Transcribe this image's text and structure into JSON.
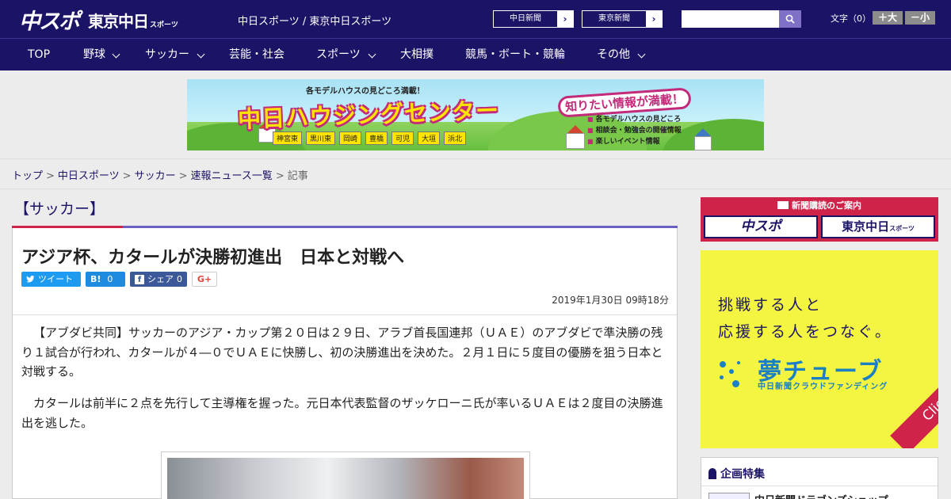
{
  "header": {
    "logo_chuspo": "中スポ",
    "logo_tokyo": "東京中日",
    "logo_tokyo_small": "スポーツ",
    "site_name": "中日スポーツ / 東京中日スポーツ",
    "paper_links": [
      {
        "label": "中日新聞"
      },
      {
        "label": "東京新聞"
      }
    ],
    "search_placeholder": "",
    "font_size_label": "文字（0）",
    "font_larger": "＋大",
    "font_smaller": "－小"
  },
  "nav": {
    "items": [
      {
        "label": "TOP",
        "dropdown": false
      },
      {
        "label": "野球",
        "dropdown": true
      },
      {
        "label": "サッカー",
        "dropdown": true
      },
      {
        "label": "芸能・社会",
        "dropdown": false
      },
      {
        "label": "スポーツ",
        "dropdown": true
      },
      {
        "label": "大相撲",
        "dropdown": false
      },
      {
        "label": "競馬・ボート・競輪",
        "dropdown": false
      },
      {
        "label": "その他",
        "dropdown": true
      }
    ]
  },
  "banner": {
    "tagline": "各モデルハウスの見どころ満載！",
    "title": "中日ハウジングセンター",
    "cities": [
      "神宮東",
      "黒川東",
      "岡崎",
      "豊橋",
      "可児",
      "大垣",
      "浜北"
    ],
    "bubble": "知りたい情報が満載！",
    "bullets": [
      "各モデルハウスの見どころ",
      "相談会・勉強会の開催情報",
      "楽しいイベント情報"
    ]
  },
  "breadcrumb": {
    "items": [
      "トップ",
      "中日スポーツ",
      "サッカー",
      "速報ニュース一覧"
    ],
    "current": "記事",
    "separator": ">"
  },
  "article": {
    "category": "【サッカー】",
    "title": "アジア杯、カタールが決勝初進出　日本と対戦へ",
    "share": {
      "tweet": "ツイート",
      "hatena_label": "B!",
      "hatena_count": "0",
      "facebook_label": "シェア",
      "facebook_count": "0",
      "gplus": "G+"
    },
    "date": "2019年1月30日 09時18分",
    "paragraphs": [
      "【アブダビ共同】サッカーのアジア・カップ第２０日は２９日、アラブ首長国連邦（ＵＡＥ）のアブダビで準決勝の残り１試合が行われ、カタールが４―０でＵＡＥに快勝し、初の決勝進出を決めた。２月１日に５度目の優勝を狙う日本と対戦する。",
      "カタールは前半に２点を先行して主導権を握った。元日本代表監督のザッケローニ氏が率いるＵＡＥは２度目の決勝進出を逃した。"
    ]
  },
  "sidebar": {
    "subscription_title": "新聞購読のご案内",
    "sub_chuspo": "中スポ",
    "sub_tokyo": "東京中日",
    "sub_tokyo_small": "スポーツ",
    "ad_line1": "挑戦する人と",
    "ad_line2": "応援する人をつなぐ。",
    "ad_brand": "夢チューブ",
    "ad_sub": "中日新聞クラウドファンディング",
    "ad_click": "Click!",
    "feature_title": "企画特集",
    "feature_item": "中日新聞ドラゴンズショップ"
  },
  "colors": {
    "brand": "#1b1365",
    "accent": "#d0234a",
    "nav_accent": "#6b5fc0"
  }
}
